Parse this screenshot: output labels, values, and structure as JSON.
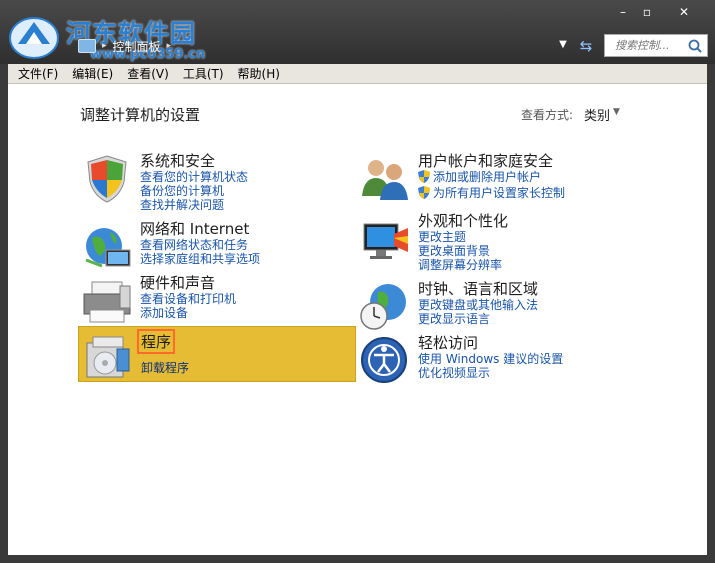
{
  "watermark": {
    "title": "河东软件园",
    "url": "www.pc0359.cn"
  },
  "window": {
    "minimize": "–",
    "maximize": "▫",
    "close": "✕"
  },
  "address": {
    "breadcrumb": "控制面板",
    "arrow": "▸"
  },
  "search": {
    "placeholder": "搜索控制..."
  },
  "menu": {
    "items": [
      "文件(F)",
      "编辑(E)",
      "查看(V)",
      "工具(T)",
      "帮助(H)"
    ]
  },
  "main": {
    "title": "调整计算机的设置",
    "view_by_label": "查看方式:",
    "view_by_value": "类别",
    "view_by_arrow": "▼"
  },
  "categories": [
    {
      "title": "系统和安全",
      "icon": "security-shield-icon",
      "links": [
        "查看您的计算机状态",
        "备份您的计算机",
        "查找并解决问题"
      ]
    },
    {
      "title": "网络和 Internet",
      "icon": "network-globe-icon",
      "links": [
        "查看网络状态和任务",
        "选择家庭组和共享选项"
      ]
    },
    {
      "title": "硬件和声音",
      "icon": "printer-icon",
      "links": [
        "查看设备和打印机",
        "添加设备"
      ]
    },
    {
      "title": "程序",
      "icon": "programs-icon",
      "links": [
        "卸载程序"
      ]
    },
    {
      "title": "用户帐户和家庭安全",
      "icon": "users-icon",
      "links": [
        "添加或删除用户帐户",
        "为所有用户设置家长控制"
      ]
    },
    {
      "title": "外观和个性化",
      "icon": "display-icon",
      "links": [
        "更改主题",
        "更改桌面背景",
        "调整屏幕分辨率"
      ]
    },
    {
      "title": "时钟、语言和区域",
      "icon": "clock-globe-icon",
      "links": [
        "更改键盘或其他输入法",
        "更改显示语言"
      ]
    },
    {
      "title": "轻松访问",
      "icon": "accessibility-icon",
      "links": [
        "使用 Windows 建议的设置",
        "优化视频显示"
      ]
    }
  ]
}
